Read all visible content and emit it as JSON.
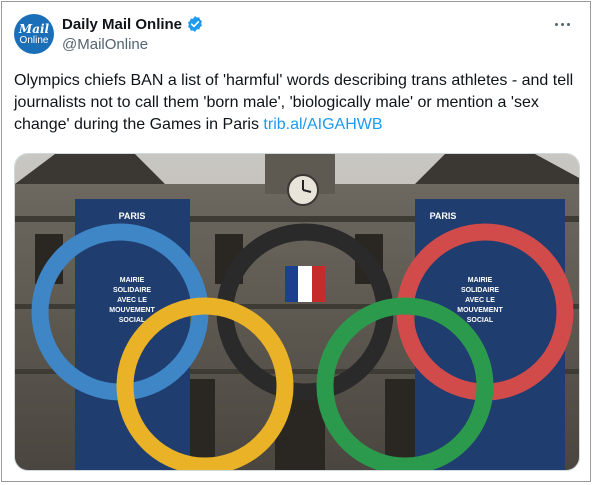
{
  "author": {
    "avatar_line1": "Mail",
    "avatar_line2": "Online",
    "display_name": "Daily Mail Online",
    "handle": "@MailOnline",
    "verified": true
  },
  "tweet": {
    "text": "Olympics chiefs BAN a list of 'harmful' words describing trans athletes - and tell journalists not to call them 'born male', 'biologically male' or mention a 'sex change' during the Games in Paris ",
    "link": "trib.al/AIGAHWB"
  },
  "media": {
    "banner_left": {
      "title": "PARIS",
      "lines": [
        "MAIRIE",
        "SOLIDAIRE",
        "AVEC LE",
        "MOUVEMENT",
        "SOCIAL"
      ]
    },
    "banner_right": {
      "title": "PARIS",
      "lines": [
        "MAIRIE",
        "SOLIDAIRE",
        "AVEC LE",
        "MOUVEMENT",
        "SOCIAL"
      ]
    },
    "ring_colors": {
      "blue": "#3f86c6",
      "yellow": "#e9b227",
      "black": "#2a2a2a",
      "green": "#2c9a4c",
      "red": "#d24b4b"
    }
  }
}
